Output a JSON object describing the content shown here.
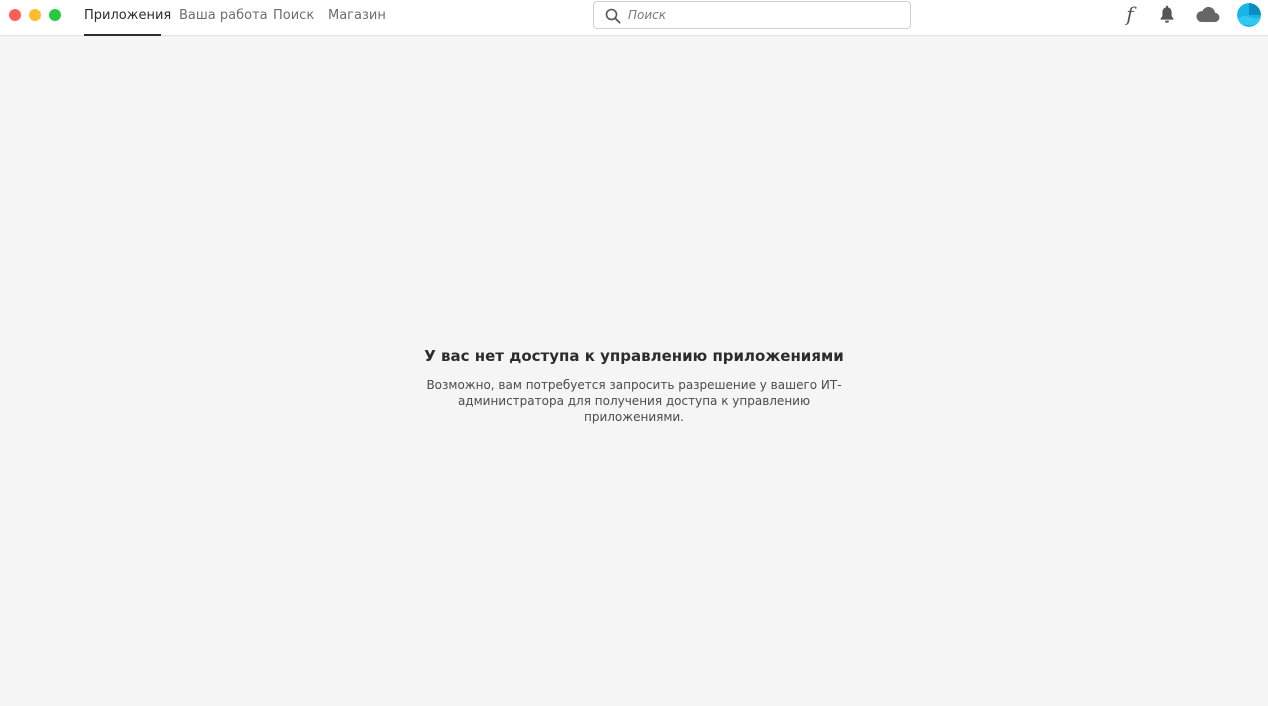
{
  "window": {
    "controls": {
      "close_color": "#ff5f57",
      "minimize_color": "#febc2e",
      "maximize_color": "#28c840"
    }
  },
  "nav": {
    "tabs": [
      {
        "label": "Приложения",
        "active": true
      },
      {
        "label": "Ваша работа",
        "active": false
      },
      {
        "label": "Поиск",
        "active": false
      },
      {
        "label": "Магазин",
        "active": false
      }
    ]
  },
  "search": {
    "placeholder": "Поиск",
    "value": "",
    "icon": "search-icon"
  },
  "toolbar": {
    "fonts_glyph": "f",
    "icons": [
      "fonts-icon",
      "bell-icon",
      "cloud-icon",
      "avatar"
    ]
  },
  "message": {
    "title": "У вас нет доступа к управлению приложениями",
    "body_line1": "Возможно, вам потребуется запросить разрешение у вашего ИТ-",
    "body_line2": "администратора для получения доступа к управлению приложениями."
  },
  "colors": {
    "background": "#f5f5f5",
    "topbar": "#ffffff",
    "active_tab": "#2c2c2c",
    "inactive_tab": "#6e6e6e",
    "avatar_accent": "#1ab5e8"
  }
}
